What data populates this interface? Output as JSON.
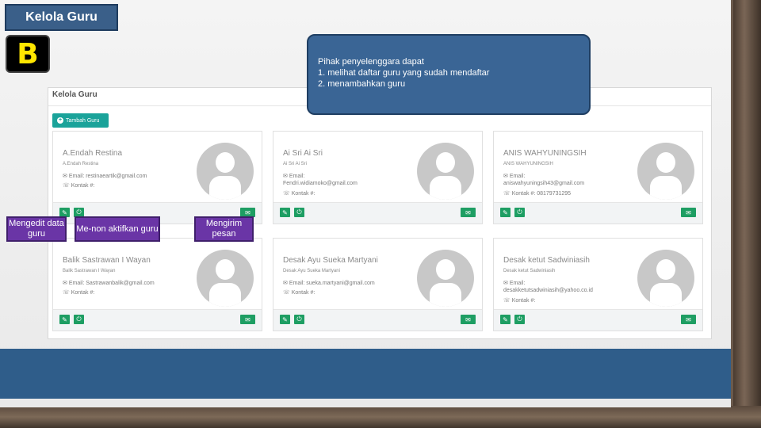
{
  "slide": {
    "title": "Kelola Guru",
    "badge": "B",
    "callout_text_line1": "Pihak penyelenggara dapat",
    "callout_text_line2": "1.  melihat daftar guru yang sudah mendaftar",
    "callout_text_line3": "2.  menambahkan guru",
    "label_edit": "Mengedit data guru",
    "label_deactivate": "Me-non aktifkan guru",
    "label_message": "Mengirim pesan"
  },
  "app": {
    "title": "Kelola Guru",
    "add_button": "Tambah Guru",
    "add_icon": "plus-circle-icon",
    "accent_color": "#1aa39a",
    "action_color": "#1e9e63"
  },
  "teachers": [
    {
      "name": "A.Endah Restina",
      "sub": "A.Endah Restina",
      "email": "Email: restinaeartik@gmail.com",
      "contact": "Kontak #:"
    },
    {
      "name": "Ai Sri Ai Sri",
      "sub": "Ai Sri Ai Sri",
      "email": "Email:",
      "email2": "Fendri.widiamoko@gmail.com",
      "contact": "Kontak #:"
    },
    {
      "name": "ANIS WAHYUNINGSIH",
      "sub": "ANIS WAHYUNINGSIH",
      "email": "Email:",
      "email2": "aniswahyuningsih43@gmail.com",
      "contact": "Kontak #: 08179731295"
    },
    {
      "name": "Balik Sastrawan I Wayan",
      "sub": "Balik Sastrawan I Wayan",
      "email": "Email: Sastrawanbalik@gmail.com",
      "contact": "Kontak #:"
    },
    {
      "name": "Desak Ayu Sueka Martyani",
      "sub": "Desak Ayu Sueka Martyani",
      "email": "Email: sueka.martyani@gmail.com",
      "contact": "Kontak #:"
    },
    {
      "name": "Desak ketut Sadwiniasih",
      "sub": "Desak ketut Sadwiniasih",
      "email": "Email:",
      "email2": "desakketutsadwiniasih@yahoo.co.id",
      "contact": "Kontak #:"
    }
  ]
}
